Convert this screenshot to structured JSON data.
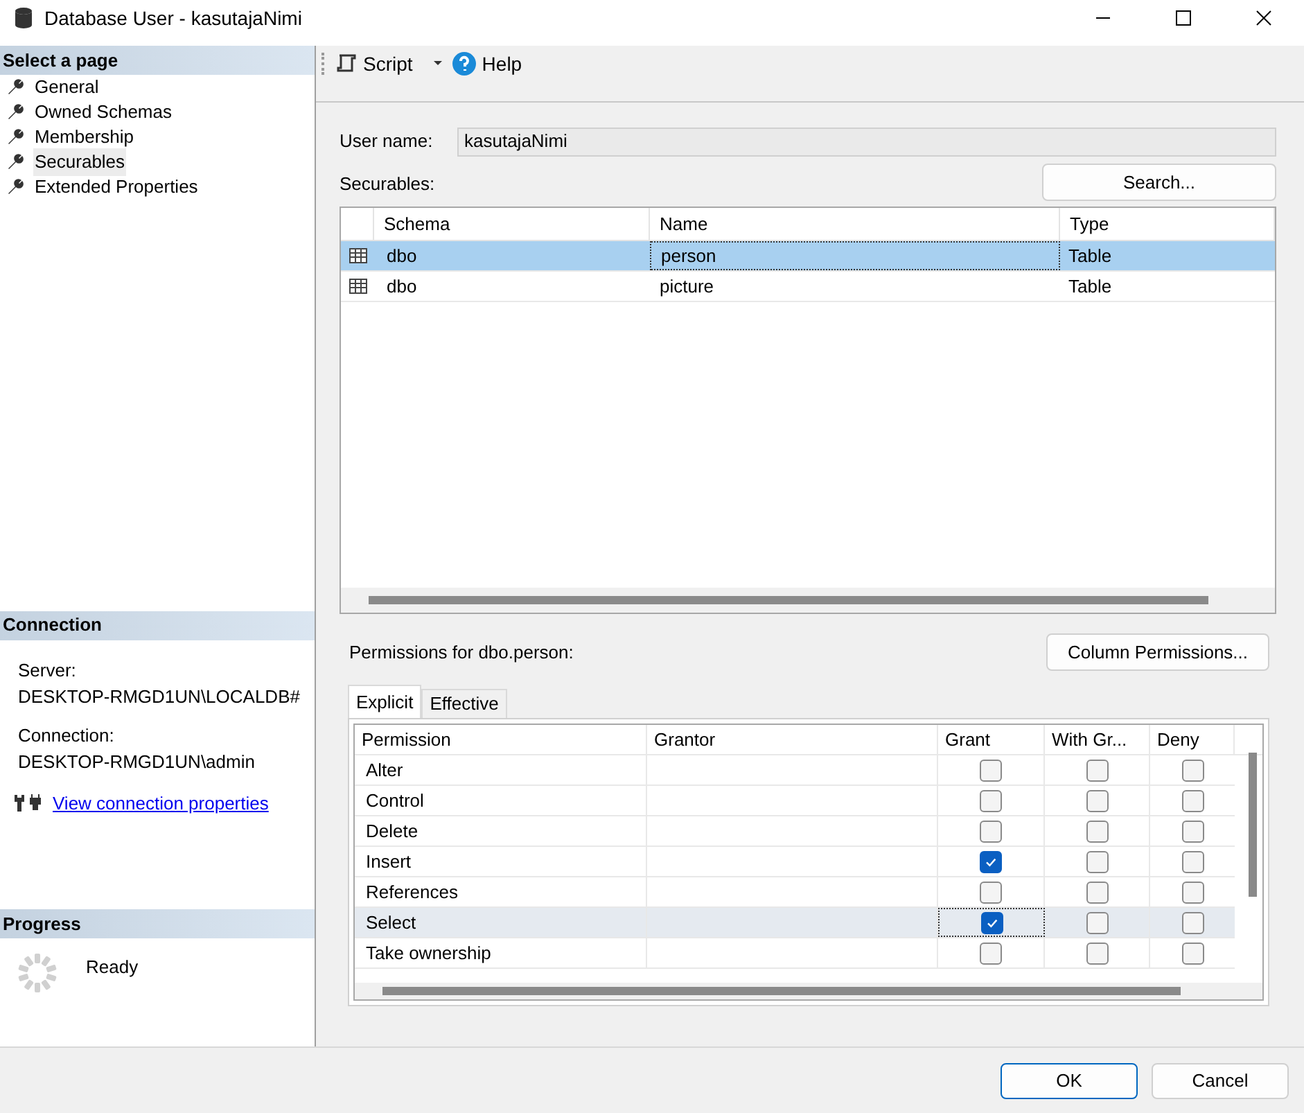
{
  "window": {
    "title": "Database User - kasutajaNimi"
  },
  "sidebar": {
    "header": "Select a page",
    "items": [
      {
        "label": "General",
        "selected": false
      },
      {
        "label": "Owned Schemas",
        "selected": false
      },
      {
        "label": "Membership",
        "selected": false
      },
      {
        "label": "Securables",
        "selected": true
      },
      {
        "label": "Extended Properties",
        "selected": false
      }
    ]
  },
  "connection": {
    "header": "Connection",
    "server_label": "Server:",
    "server": "DESKTOP-RMGD1UN\\LOCALDB#",
    "connection_label": "Connection:",
    "connection": "DESKTOP-RMGD1UN\\admin",
    "link": "View connection properties"
  },
  "progress": {
    "header": "Progress",
    "status": "Ready"
  },
  "toolbar": {
    "script": "Script",
    "help": "Help"
  },
  "user_name": {
    "label": "User name:",
    "value": "kasutajaNimi"
  },
  "securables": {
    "label": "Securables:",
    "search_button": "Search...",
    "columns": [
      "Schema",
      "Name",
      "Type"
    ],
    "rows": [
      {
        "schema": "dbo",
        "name": "person",
        "type": "Table",
        "selected": true
      },
      {
        "schema": "dbo",
        "name": "picture",
        "type": "Table",
        "selected": false
      }
    ]
  },
  "permissions": {
    "label": "Permissions for dbo.person:",
    "column_button": "Column Permissions...",
    "tabs": [
      {
        "label": "Explicit",
        "selected": true
      },
      {
        "label": "Effective",
        "selected": false
      }
    ],
    "columns": [
      "Permission",
      "Grantor",
      "Grant",
      "With Gr...",
      "Deny"
    ],
    "rows": [
      {
        "permission": "Alter",
        "grant": false,
        "with_grant": false,
        "deny": false,
        "selected": false
      },
      {
        "permission": "Control",
        "grant": false,
        "with_grant": false,
        "deny": false,
        "selected": false
      },
      {
        "permission": "Delete",
        "grant": false,
        "with_grant": false,
        "deny": false,
        "selected": false
      },
      {
        "permission": "Insert",
        "grant": true,
        "with_grant": false,
        "deny": false,
        "selected": false
      },
      {
        "permission": "References",
        "grant": false,
        "with_grant": false,
        "deny": false,
        "selected": false
      },
      {
        "permission": "Select",
        "grant": true,
        "with_grant": false,
        "deny": false,
        "selected": true
      },
      {
        "permission": "Take ownership",
        "grant": false,
        "with_grant": false,
        "deny": false,
        "selected": false
      }
    ]
  },
  "buttons": [
    "OK",
    "Cancel"
  ]
}
